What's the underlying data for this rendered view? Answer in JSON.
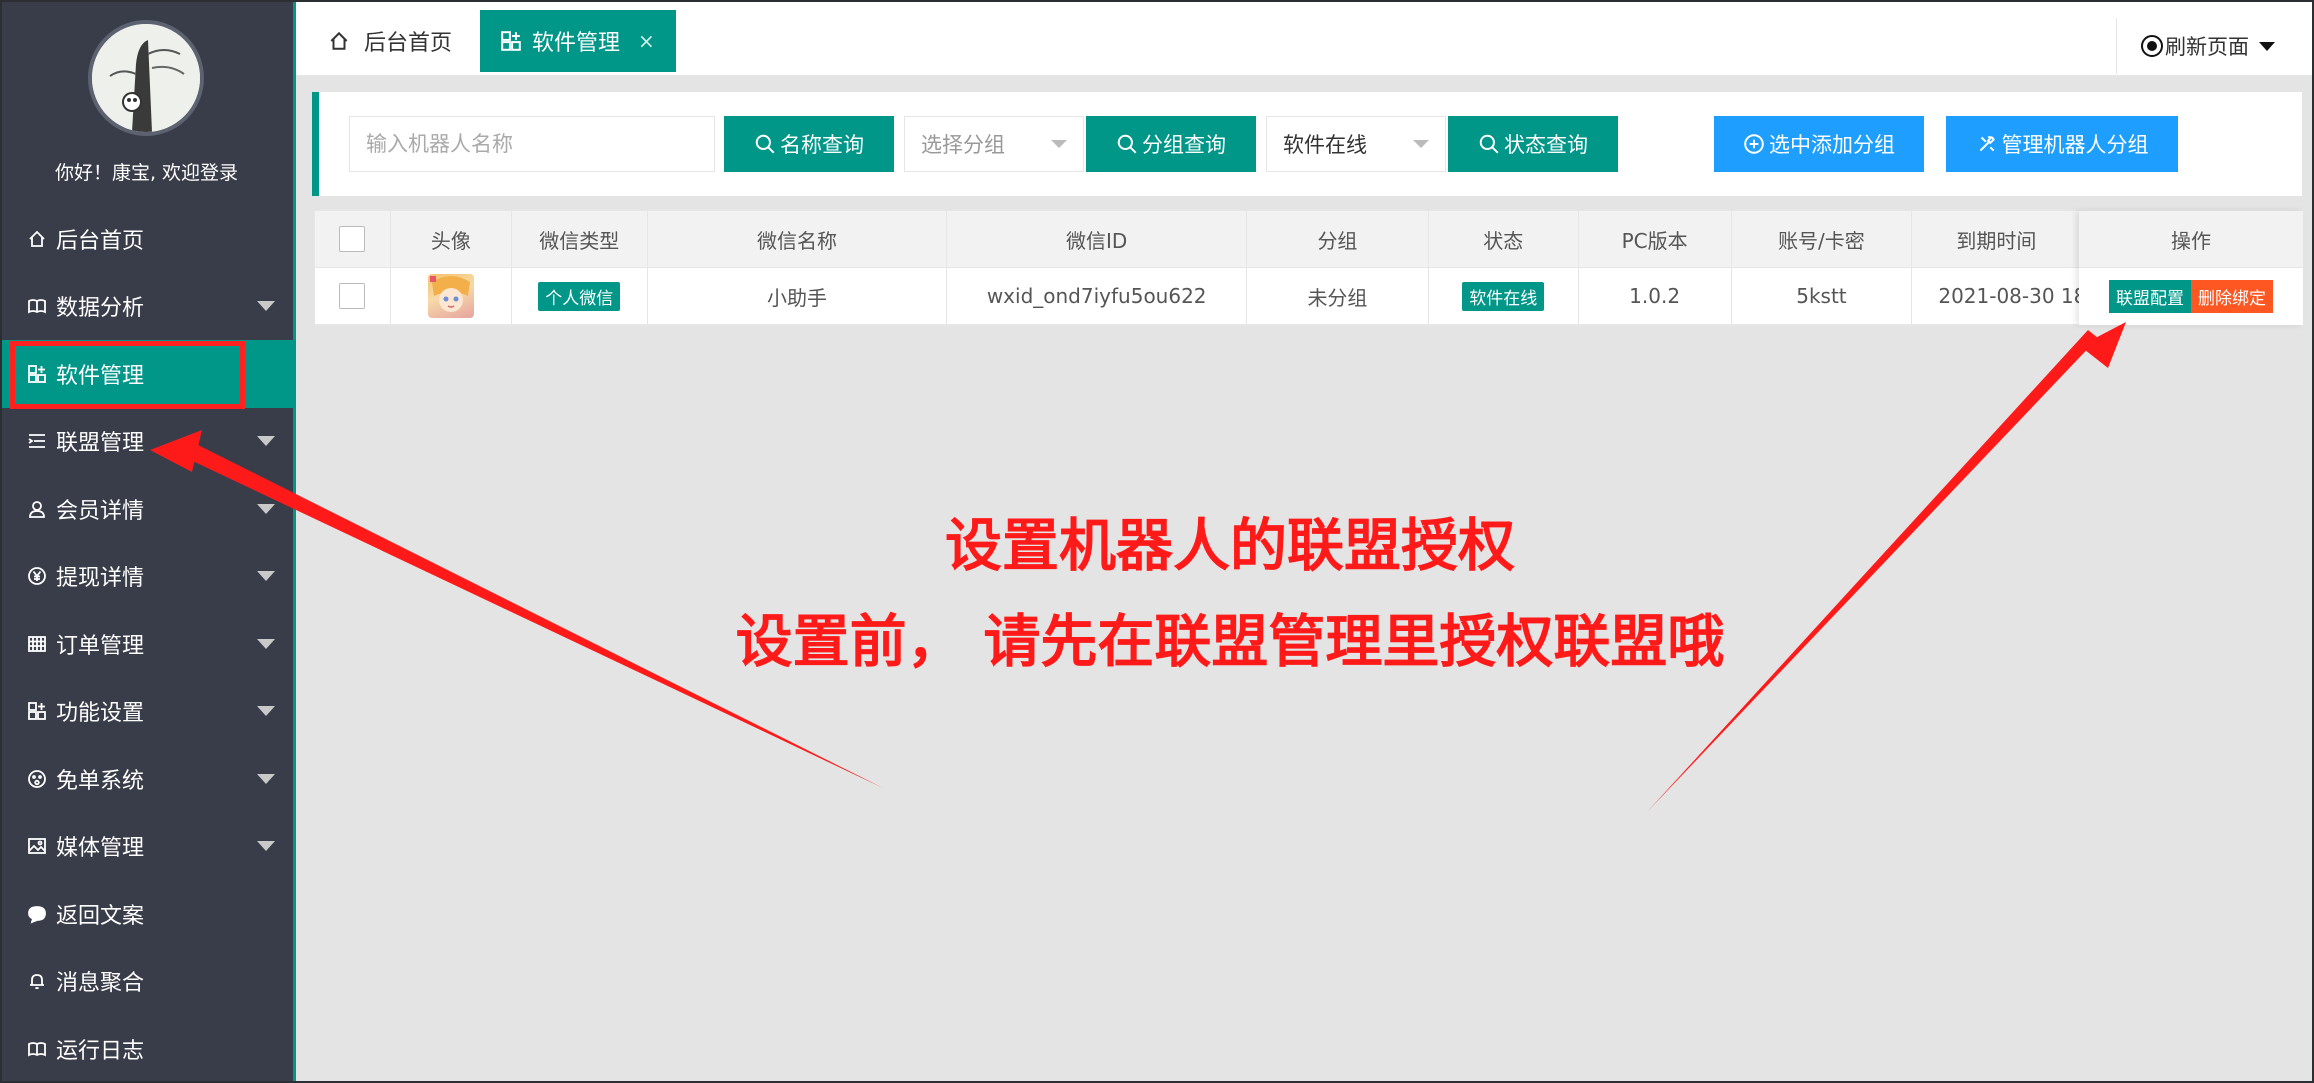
{
  "sidebar": {
    "welcome": "你好！康宝, 欢迎登录",
    "items": [
      {
        "label": "后台首页",
        "icon": "home-icon",
        "has_caret": false
      },
      {
        "label": "数据分析",
        "icon": "book-icon",
        "has_caret": true
      },
      {
        "label": "软件管理",
        "icon": "apps-icon",
        "has_caret": false,
        "active": true
      },
      {
        "label": "联盟管理",
        "icon": "list-icon",
        "has_caret": true
      },
      {
        "label": "会员详情",
        "icon": "user-icon",
        "has_caret": true
      },
      {
        "label": "提现详情",
        "icon": "yen-icon",
        "has_caret": true
      },
      {
        "label": "订单管理",
        "icon": "grid-icon",
        "has_caret": true
      },
      {
        "label": "功能设置",
        "icon": "apps-icon",
        "has_caret": true
      },
      {
        "label": "免单系统",
        "icon": "face-icon",
        "has_caret": true
      },
      {
        "label": "媒体管理",
        "icon": "image-icon",
        "has_caret": true
      },
      {
        "label": "返回文案",
        "icon": "chat-icon",
        "has_caret": false
      },
      {
        "label": "消息聚合",
        "icon": "bell-icon",
        "has_caret": false
      },
      {
        "label": "运行日志",
        "icon": "book-icon",
        "has_caret": false
      }
    ]
  },
  "tabs": {
    "home": "后台首页",
    "current": "软件管理",
    "close": "×",
    "refresh": "刷新页面"
  },
  "search": {
    "name_placeholder": "输入机器人名称",
    "name_btn": "名称查询",
    "group_select": "选择分组",
    "group_btn": "分组查询",
    "status_select": "软件在线",
    "status_btn": "状态查询",
    "add_group_btn": "选中添加分组",
    "manage_group_btn": "管理机器人分组"
  },
  "table": {
    "headers": [
      "头像",
      "微信类型",
      "微信名称",
      "微信ID",
      "分组",
      "状态",
      "PC版本",
      "账号/卡密",
      "到期时间",
      "操作"
    ],
    "rows": [
      {
        "type": "个人微信",
        "name": "小助手",
        "wxid": "wxid_ond7iyfu5ou622",
        "group": "未分组",
        "status": "软件在线",
        "version": "1.0.2",
        "account": "5kstt",
        "expire": "2021-08-30 18",
        "op_config": "联盟配置",
        "op_delete": "删除绑定"
      }
    ]
  },
  "annotation": {
    "line1": "设置机器人的联盟授权",
    "line2": "设置前， 请先在联盟管理里授权联盟哦",
    "color": "#ff1a1a"
  },
  "colors": {
    "sidebar_bg": "#393d49",
    "accent": "#009688",
    "blue": "#1e9fff",
    "danger": "#ff5722"
  }
}
